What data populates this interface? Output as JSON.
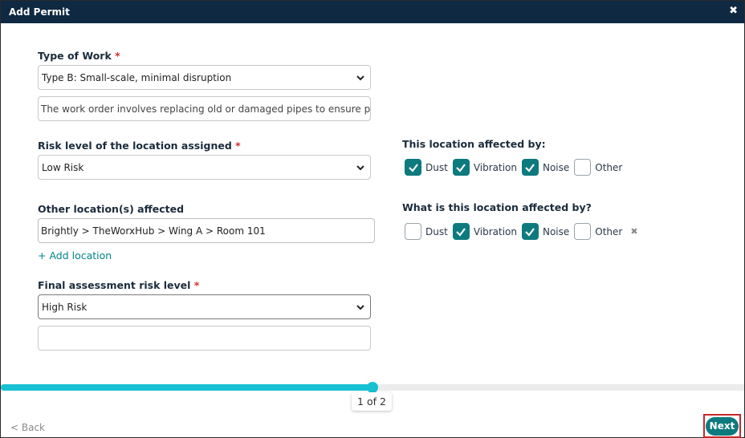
{
  "dialog": {
    "title": "Add Permit",
    "close_glyph": "✖"
  },
  "form": {
    "type_of_work": {
      "label": "Type of Work",
      "required_mark": "*",
      "value": "Type B: Small-scale, minimal disruption",
      "description": "The work order involves replacing old or damaged pipes to ensure prope"
    },
    "risk_level": {
      "label": "Risk level of the location assigned",
      "required_mark": "*",
      "value": "Low Risk"
    },
    "other_locations": {
      "label": "Other location(s) affected",
      "value": "Brightly > TheWorxHub > Wing A > Room 101",
      "add_link": "+ Add location"
    },
    "final_risk": {
      "label": "Final assessment risk level",
      "required_mark": "*",
      "value": "High Risk",
      "notes": ""
    },
    "affected_by_1": {
      "label": "This location affected by:",
      "options": [
        {
          "label": "Dust",
          "checked": true
        },
        {
          "label": "Vibration",
          "checked": true
        },
        {
          "label": "Noise",
          "checked": true
        },
        {
          "label": "Other",
          "checked": false
        }
      ]
    },
    "affected_by_2": {
      "label": "What is this location affected by?",
      "options": [
        {
          "label": "Dust",
          "checked": false
        },
        {
          "label": "Vibration",
          "checked": true
        },
        {
          "label": "Noise",
          "checked": true
        },
        {
          "label": "Other",
          "checked": false
        }
      ],
      "clear_glyph": "✖"
    }
  },
  "footer": {
    "page_indicator": "1 of 2",
    "progress_fraction": 0.5,
    "back_label": "< Back",
    "next_label": "Next"
  },
  "colors": {
    "titlebar": "#0f2942",
    "accent": "#0d7a7e",
    "progress": "#18c1d2",
    "required": "#d32f2f",
    "highlight_outline": "#c62828"
  }
}
